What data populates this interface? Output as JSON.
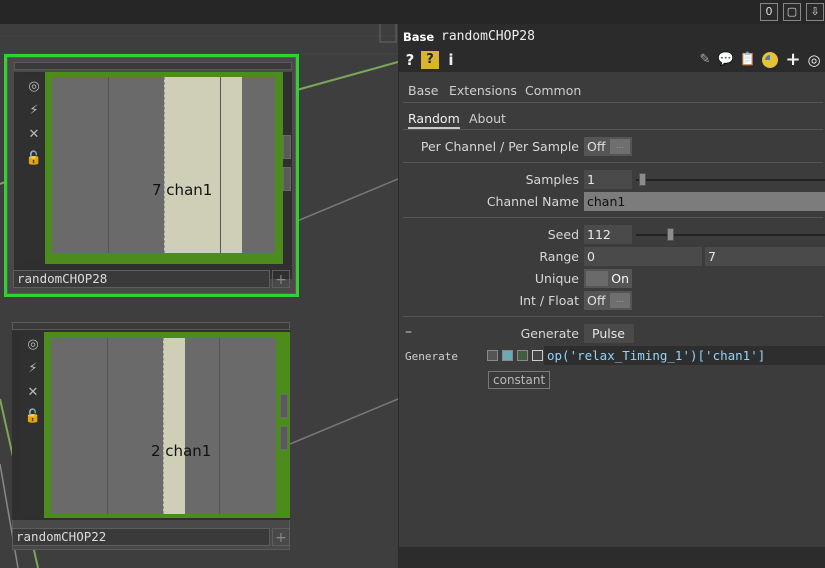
{
  "topbar": {
    "buttons": [
      {
        "name": "shortcut-0-button",
        "glyph": "0"
      },
      {
        "name": "window-icon",
        "glyph": "▢"
      },
      {
        "name": "down-arrow-icon",
        "glyph": "⇩"
      }
    ]
  },
  "network": {
    "nodes": [
      {
        "name": "randomCHOP28",
        "label": "randomCHOP28",
        "value_text": "7 chan1",
        "value": 7,
        "selected": true
      },
      {
        "name": "randomCHOP22",
        "label": "randomCHOP22",
        "value_text": "2 chan1",
        "value": 2,
        "selected": false
      }
    ],
    "node_tools": [
      "target-icon",
      "pulse-icon",
      "close-icon",
      "lock-icon"
    ]
  },
  "panel": {
    "type_label": "Base",
    "op_name": "randomCHOP28",
    "header_icons": {
      "left": [
        "help-icon",
        "python-help-icon",
        "info-icon"
      ],
      "right": [
        "edit-icon",
        "comment-icon",
        "clipboard-icon",
        "python-icon",
        "add-icon",
        "target-icon"
      ]
    },
    "tabs_row1": [
      "Base",
      "Extensions",
      "Common"
    ],
    "tabs_row2": [
      "Random",
      "About"
    ],
    "active_tab_row2": "Random",
    "params": {
      "per_channel": {
        "label": "Per Channel / Per Sample",
        "value": "Off",
        "button": "..."
      },
      "samples": {
        "label": "Samples",
        "value": "1"
      },
      "channel_name": {
        "label": "Channel Name",
        "value": "chan1"
      },
      "seed": {
        "label": "Seed",
        "value": "112"
      },
      "range": {
        "label": "Range",
        "min": "0",
        "max": "7"
      },
      "unique": {
        "label": "Unique",
        "value": "On"
      },
      "int_float": {
        "label": "Int / Float",
        "value": "Off",
        "button": "..."
      },
      "generate": {
        "label": "Generate",
        "value": "Pulse",
        "collapse": "–"
      },
      "generate_expr": {
        "label": "Generate",
        "expression": "op('relax_Timing_1')['chan1']",
        "mode": "constant"
      }
    }
  }
}
